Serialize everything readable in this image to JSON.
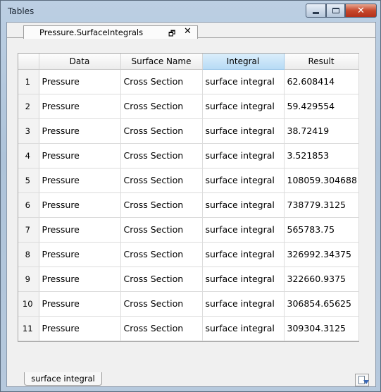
{
  "window": {
    "title": "Tables",
    "buttons": {
      "minimize": "minimize",
      "maximize": "maximize",
      "close": "✕"
    }
  },
  "doc_tab": {
    "label": "Pressure.SurfaceIntegrals",
    "undock_symbol": "🗗",
    "close_symbol": "✕"
  },
  "table": {
    "columns": [
      "",
      "Data",
      "Surface Name",
      "Integral",
      "Result"
    ],
    "selected_column": "Integral",
    "rows": [
      [
        "1",
        "Pressure",
        "Cross Section",
        "surface integral",
        "62.608414"
      ],
      [
        "2",
        "Pressure",
        "Cross Section",
        "surface integral",
        "59.429554"
      ],
      [
        "3",
        "Pressure",
        "Cross Section",
        "surface integral",
        "38.72419"
      ],
      [
        "4",
        "Pressure",
        "Cross Section",
        "surface integral",
        "3.521853"
      ],
      [
        "5",
        "Pressure",
        "Cross Section",
        "surface integral",
        "108059.304688"
      ],
      [
        "6",
        "Pressure",
        "Cross Section",
        "surface integral",
        "738779.3125"
      ],
      [
        "7",
        "Pressure",
        "Cross Section",
        "surface integral",
        "565783.75"
      ],
      [
        "8",
        "Pressure",
        "Cross Section",
        "surface integral",
        "326992.34375"
      ],
      [
        "9",
        "Pressure",
        "Cross Section",
        "surface integral",
        "322660.9375"
      ],
      [
        "10",
        "Pressure",
        "Cross Section",
        "surface integral",
        "306854.65625"
      ],
      [
        "11",
        "Pressure",
        "Cross Section",
        "surface integral",
        "309304.3125"
      ]
    ]
  },
  "sheet_tab": {
    "label": "surface integral"
  },
  "icons": {
    "export": "export-icon"
  },
  "colors": {
    "selected_header": "#b7dbf5",
    "close_button": "#c7472b"
  }
}
